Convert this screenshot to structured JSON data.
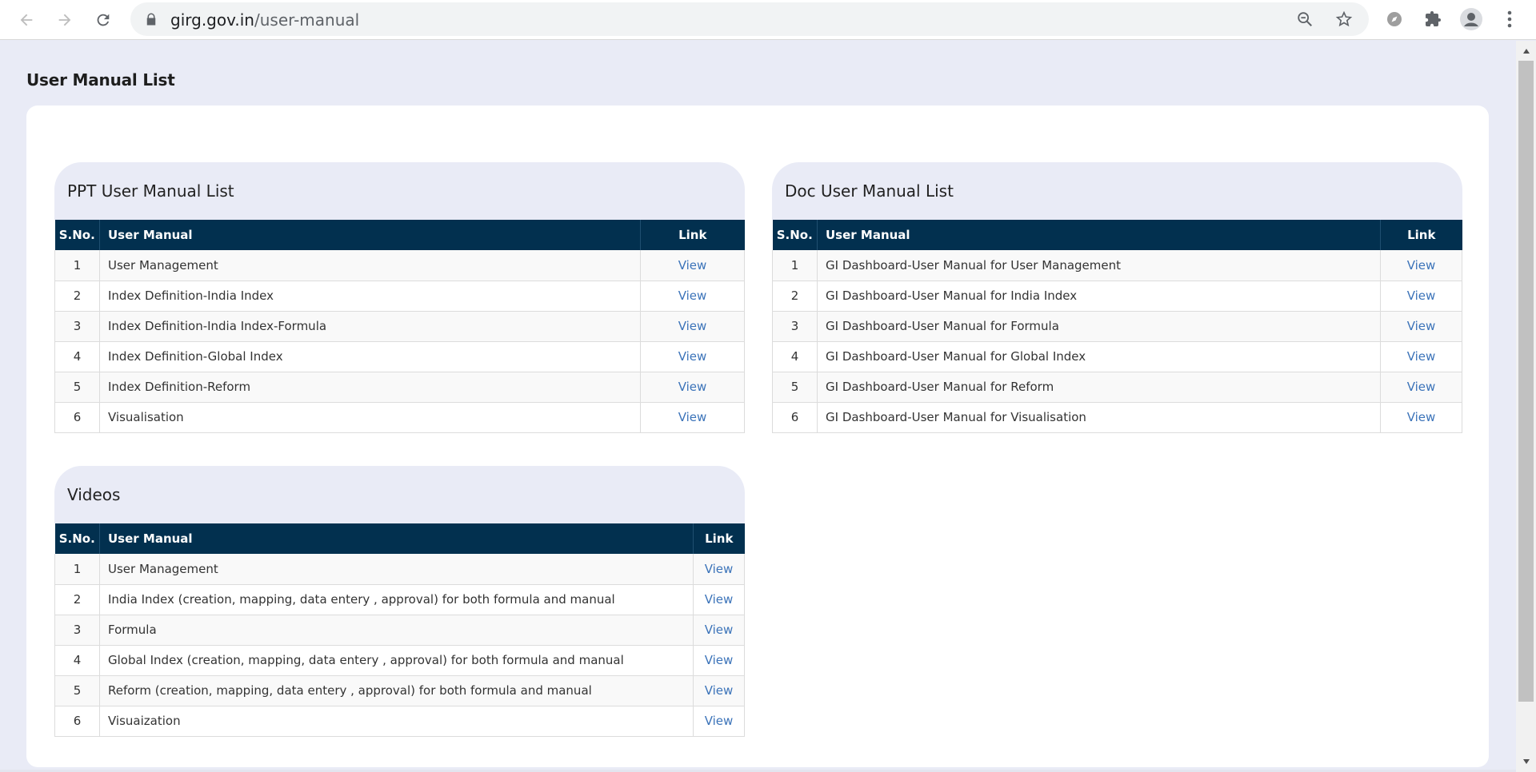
{
  "browser": {
    "url_host": "girg.gov.in",
    "url_path": "/user-manual"
  },
  "page": {
    "title": "User Manual List"
  },
  "ppt": {
    "title": "PPT User Manual List",
    "headers": {
      "sno": "S.No.",
      "manual": "User Manual",
      "link": "Link"
    },
    "rows": [
      {
        "sno": "1",
        "name": "User Management",
        "link": "View"
      },
      {
        "sno": "2",
        "name": "Index Definition-India Index",
        "link": "View"
      },
      {
        "sno": "3",
        "name": "Index Definition-India Index-Formula",
        "link": "View"
      },
      {
        "sno": "4",
        "name": "Index Definition-Global Index",
        "link": "View"
      },
      {
        "sno": "5",
        "name": "Index Definition-Reform",
        "link": "View"
      },
      {
        "sno": "6",
        "name": "Visualisation",
        "link": "View"
      }
    ]
  },
  "doc": {
    "title": "Doc User Manual List",
    "headers": {
      "sno": "S.No.",
      "manual": "User Manual",
      "link": "Link"
    },
    "rows": [
      {
        "sno": "1",
        "name": "GI Dashboard-User Manual for User Management",
        "link": "View"
      },
      {
        "sno": "2",
        "name": "GI Dashboard-User Manual for India Index",
        "link": "View"
      },
      {
        "sno": "3",
        "name": "GI Dashboard-User Manual for Formula",
        "link": "View"
      },
      {
        "sno": "4",
        "name": "GI Dashboard-User Manual for Global Index",
        "link": "View"
      },
      {
        "sno": "5",
        "name": "GI Dashboard-User Manual for Reform",
        "link": "View"
      },
      {
        "sno": "6",
        "name": "GI Dashboard-User Manual for Visualisation",
        "link": "View"
      }
    ]
  },
  "videos": {
    "title": "Videos",
    "headers": {
      "sno": "S.No.",
      "manual": "User Manual",
      "link": "Link"
    },
    "rows": [
      {
        "sno": "1",
        "name": "User Management",
        "link": "View"
      },
      {
        "sno": "2",
        "name": "India Index (creation, mapping, data entery , approval) for both formula and manual",
        "link": "View"
      },
      {
        "sno": "3",
        "name": "Formula",
        "link": "View"
      },
      {
        "sno": "4",
        "name": "Global Index (creation, mapping, data entery , approval) for both formula and manual",
        "link": "View"
      },
      {
        "sno": "5",
        "name": "Reform (creation, mapping, data entery , approval) for both formula and manual",
        "link": "View"
      },
      {
        "sno": "6",
        "name": "Visuaization",
        "link": "View"
      }
    ]
  },
  "colors": {
    "table_header": "#02304f",
    "link": "#3b73b9",
    "page_bg": "#e9ebf6"
  }
}
